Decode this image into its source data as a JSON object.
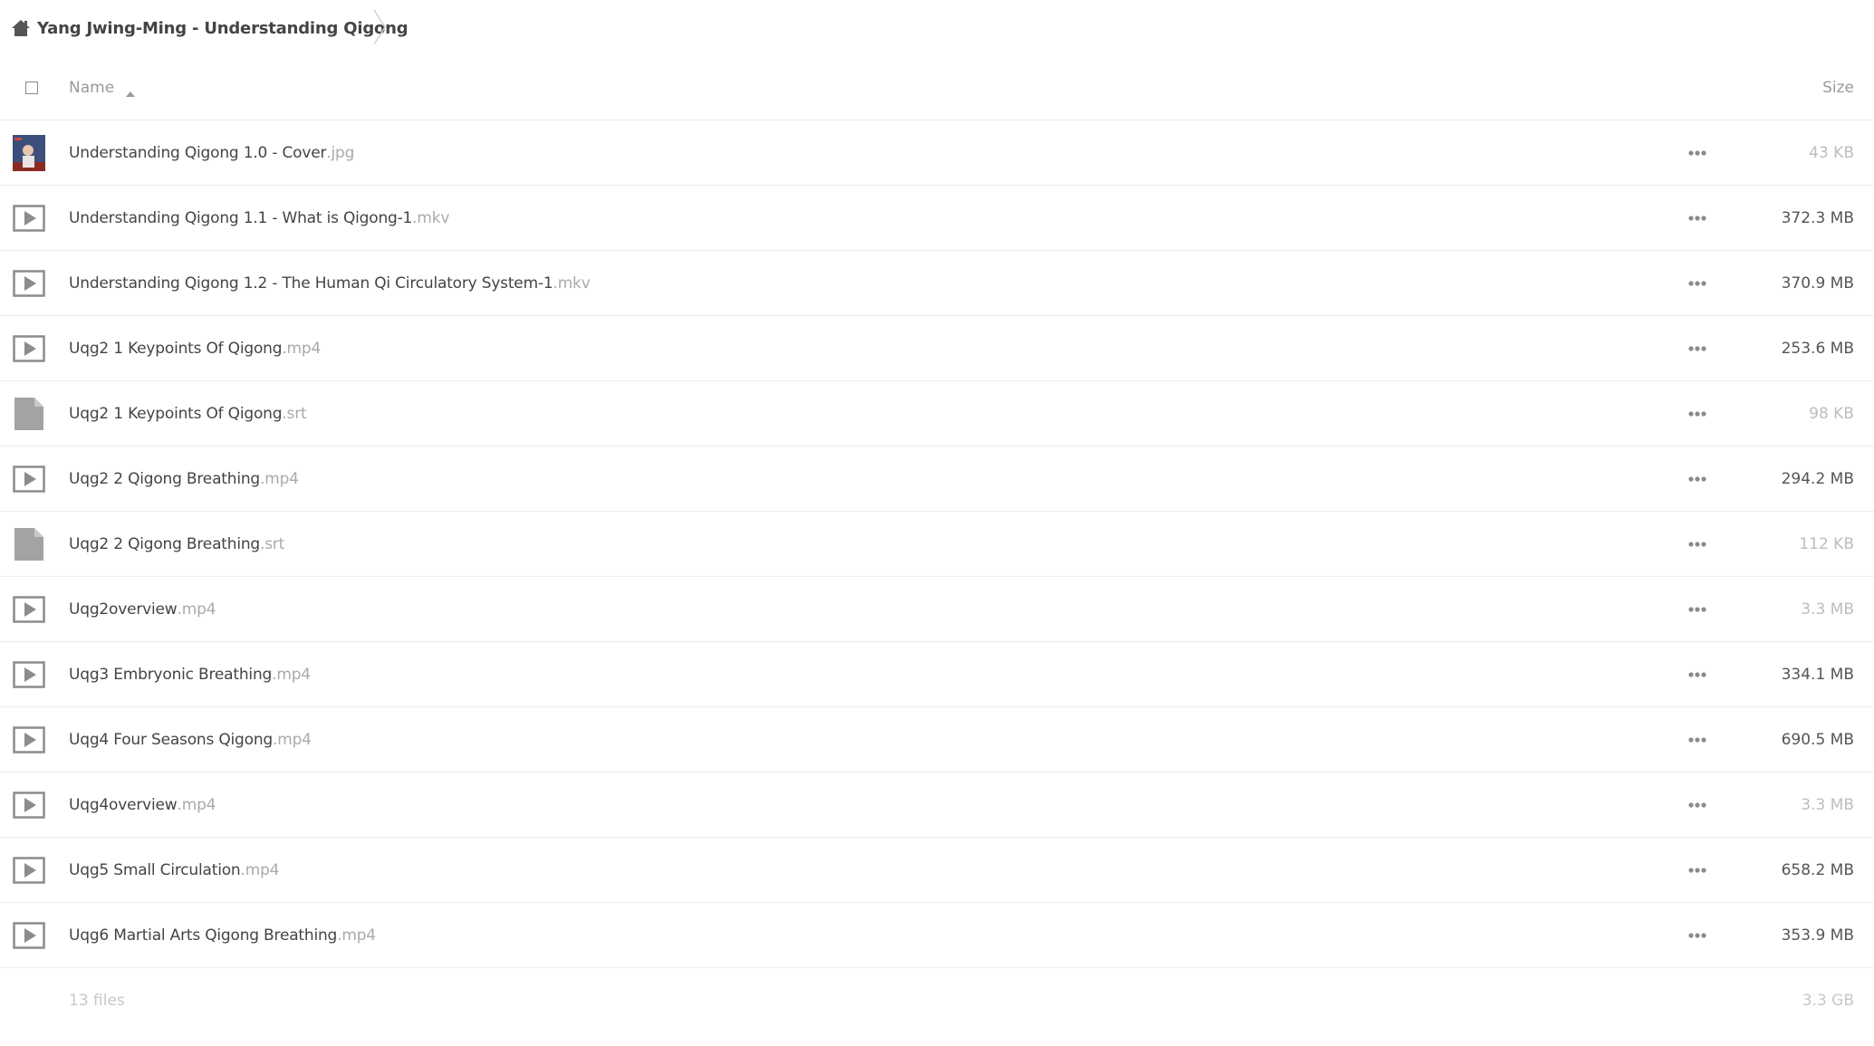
{
  "breadcrumb": {
    "home_icon": "home-icon",
    "folder_label": "Yang Jwing-Ming - Understanding Qigong",
    "separator_icon": "chevron-right-icon"
  },
  "table_header": {
    "name_label": "Name",
    "sort_icon": "sort-ascending-icon",
    "size_label": "Size"
  },
  "files": [
    {
      "name": "Understanding Qigong 1.0 - Cover",
      "ext": ".jpg",
      "size": "43 KB",
      "icon": "image-thumbnail",
      "size_color": "#bdbdbd"
    },
    {
      "name": "Understanding Qigong 1.1 - What is Qigong-1",
      "ext": ".mkv",
      "size": "372.3 MB",
      "icon": "video-icon",
      "size_color": "#555555"
    },
    {
      "name": "Understanding Qigong 1.2 - The Human Qi Circulatory System-1",
      "ext": ".mkv",
      "size": "370.9 MB",
      "icon": "video-icon",
      "size_color": "#555555"
    },
    {
      "name": "Uqg2 1 Keypoints Of Qigong",
      "ext": ".mp4",
      "size": "253.6 MB",
      "icon": "video-icon",
      "size_color": "#555555"
    },
    {
      "name": "Uqg2 1 Keypoints Of Qigong",
      "ext": ".srt",
      "size": "98 KB",
      "icon": "file-icon",
      "size_color": "#bdbdbd"
    },
    {
      "name": "Uqg2 2 Qigong Breathing",
      "ext": ".mp4",
      "size": "294.2 MB",
      "icon": "video-icon",
      "size_color": "#555555"
    },
    {
      "name": "Uqg2 2 Qigong Breathing",
      "ext": ".srt",
      "size": "112 KB",
      "icon": "file-icon",
      "size_color": "#bdbdbd"
    },
    {
      "name": "Uqg2overview",
      "ext": ".mp4",
      "size": "3.3 MB",
      "icon": "video-icon",
      "size_color": "#bdbdbd"
    },
    {
      "name": "Uqg3 Embryonic Breathing",
      "ext": ".mp4",
      "size": "334.1 MB",
      "icon": "video-icon",
      "size_color": "#555555"
    },
    {
      "name": "Uqg4 Four Seasons Qigong",
      "ext": ".mp4",
      "size": "690.5 MB",
      "icon": "video-icon",
      "size_color": "#555555"
    },
    {
      "name": "Uqg4overview",
      "ext": ".mp4",
      "size": "3.3 MB",
      "icon": "video-icon",
      "size_color": "#bdbdbd"
    },
    {
      "name": "Uqg5 Small Circulation",
      "ext": ".mp4",
      "size": "658.2 MB",
      "icon": "video-icon",
      "size_color": "#555555"
    },
    {
      "name": "Uqg6 Martial Arts Qigong Breathing",
      "ext": ".mp4",
      "size": "353.9 MB",
      "icon": "video-icon",
      "size_color": "#555555"
    }
  ],
  "more_icon": "more-horizontal-icon",
  "summary": {
    "count": "13 files",
    "total_size": "3.3 GB"
  }
}
